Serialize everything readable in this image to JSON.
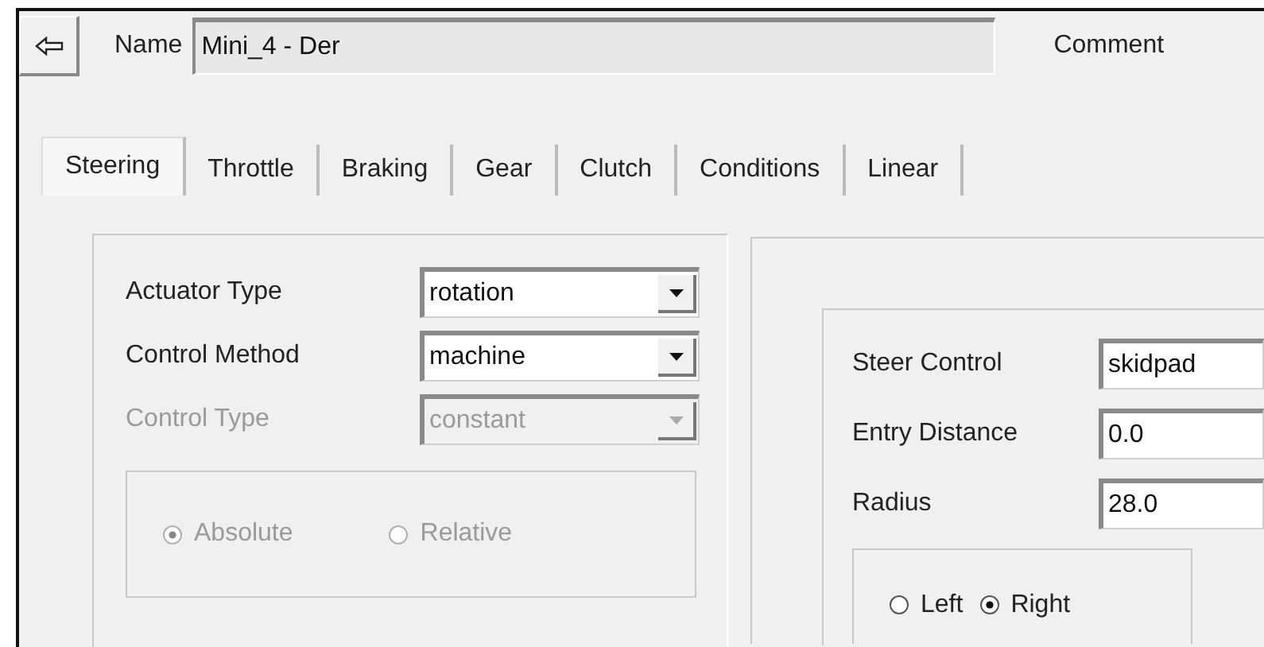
{
  "name_field": {
    "label": "Name",
    "value": "Mini_4 - Der"
  },
  "comment": {
    "label": "Comment"
  },
  "tabs": [
    {
      "label": "Steering",
      "selected": true
    },
    {
      "label": "Throttle",
      "selected": false
    },
    {
      "label": "Braking",
      "selected": false
    },
    {
      "label": "Gear",
      "selected": false
    },
    {
      "label": "Clutch",
      "selected": false
    },
    {
      "label": "Conditions",
      "selected": false
    },
    {
      "label": "Linear",
      "selected": false
    }
  ],
  "left_panel": {
    "fields": [
      {
        "label": "Actuator Type",
        "value": "rotation",
        "disabled": false
      },
      {
        "label": "Control Method",
        "value": "machine",
        "disabled": false
      },
      {
        "label": "Control Type",
        "value": "constant",
        "disabled": true
      }
    ],
    "mode_options": [
      {
        "label": "Absolute",
        "selected": true,
        "disabled": true
      },
      {
        "label": "Relative",
        "selected": false,
        "disabled": true
      }
    ]
  },
  "right_panel": {
    "fields": [
      {
        "label": "Steer Control",
        "value": "skidpad"
      },
      {
        "label": "Entry Distance",
        "value": "0.0"
      },
      {
        "label": "Radius",
        "value": "28.0"
      }
    ],
    "direction_options": [
      {
        "label": "Left",
        "selected": false,
        "disabled": false
      },
      {
        "label": "Right",
        "selected": true,
        "disabled": false
      }
    ]
  }
}
